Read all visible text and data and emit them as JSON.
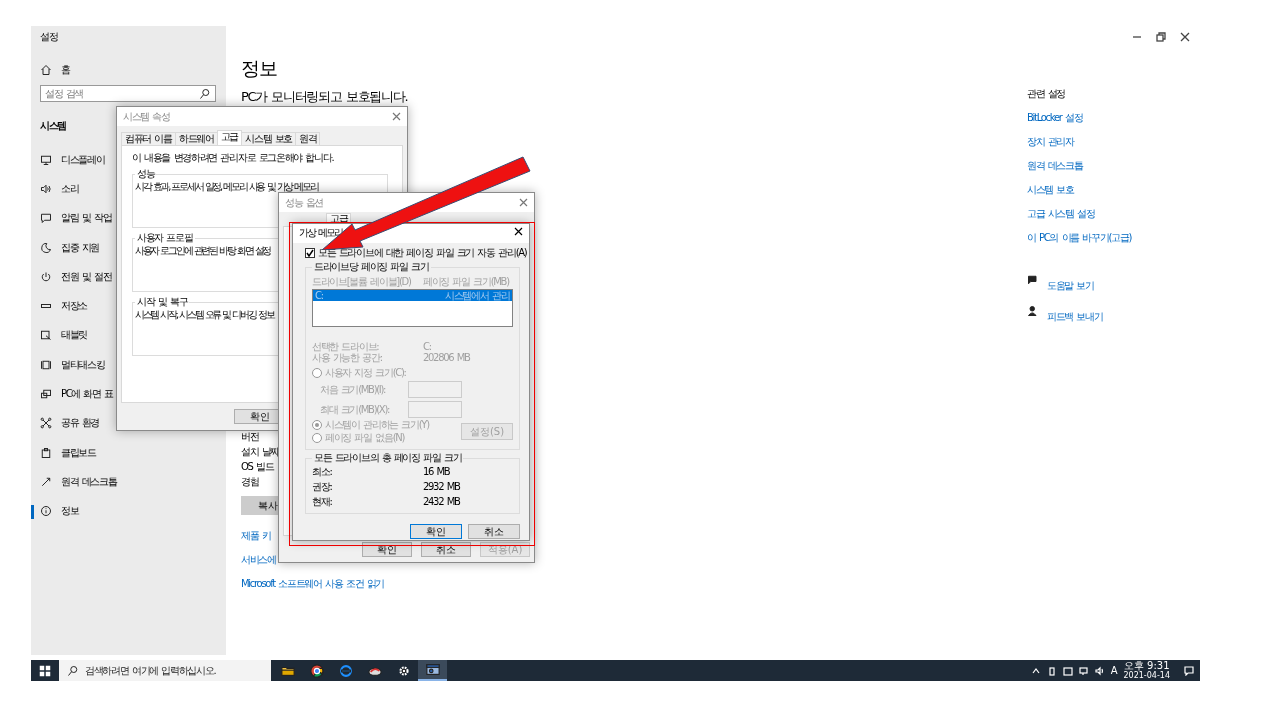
{
  "settings": {
    "title": "설정",
    "sidebar": {
      "home": "홈",
      "search": {
        "placeholder": "설정 검색"
      },
      "section": "시스템",
      "items": [
        {
          "label": "디스플레이",
          "selected": false
        },
        {
          "label": "소리",
          "selected": false
        },
        {
          "label": "알림 및 작업",
          "selected": false
        },
        {
          "label": "집중 지원",
          "selected": false
        },
        {
          "label": "전원 및 절전",
          "selected": false
        },
        {
          "label": "저장소",
          "selected": false
        },
        {
          "label": "태블릿",
          "selected": false
        },
        {
          "label": "멀티태스킹",
          "selected": false
        },
        {
          "label": "PC에 화면 표",
          "selected": false
        },
        {
          "label": "공유 환경",
          "selected": false
        },
        {
          "label": "클립보드",
          "selected": false
        },
        {
          "label": "원격 데스크톱",
          "selected": false
        },
        {
          "label": "정보",
          "selected": true
        }
      ]
    },
    "content": {
      "heading": "정보",
      "status": "PC가 모니터링되고 보호됩니다.",
      "spec_labels": [
        "버전",
        "설치 날짜",
        "OS 빌드",
        "경험"
      ],
      "copy_button": "복사",
      "links": [
        "제품 키",
        "서비스에",
        "Microsoft 소프트웨어 사용 조건 읽기"
      ]
    },
    "related": {
      "heading": "관련 설정",
      "links": [
        "BitLocker 설정",
        "장치 관리자",
        "원격 데스크톱",
        "시스템 보호",
        "고급 시스템 설정",
        "이 PC의 이름 바꾸기(고급)"
      ],
      "help": [
        "도움말 보기",
        "피드백 보내기"
      ]
    }
  },
  "system_properties": {
    "title": "시스템 속성",
    "tabs": [
      {
        "label": "컴퓨터 이름",
        "selected": false
      },
      {
        "label": "하드웨어",
        "selected": false
      },
      {
        "label": "고급",
        "selected": true
      },
      {
        "label": "시스템 보호",
        "selected": false
      },
      {
        "label": "원격",
        "selected": false
      }
    ],
    "notice": "이 내용을 변경하려면 관리자로 로그온해야 합니다.",
    "groups": [
      {
        "title": "성능",
        "description": "시각 효과, 프로세서 일정, 메모리 사용 및 가상 메모리"
      },
      {
        "title": "사용자 프로필",
        "description": "사용자 로그인에 관련된 바탕 화면 설정"
      },
      {
        "title": "시작 및 복구",
        "description": "시스템 시작, 시스템 오류 및 디버깅 정보"
      }
    ],
    "buttons": [
      "확인"
    ]
  },
  "performance_options": {
    "title": "성능 옵션",
    "tabs": [
      {
        "label": "고급",
        "selected": true
      }
    ],
    "buttons": [
      {
        "label": "확인",
        "disabled": false
      },
      {
        "label": "취소",
        "disabled": false
      },
      {
        "label": "적용(A)",
        "disabled": true
      }
    ]
  },
  "virtual_memory": {
    "title": "가상 메모리",
    "auto_manage": {
      "label": "모든 드라이브에 대한 페이징 파일 크기 자동 관리(A)",
      "checked": true
    },
    "per_drive": {
      "title": "드라이브당 페이징 파일 크기",
      "columns": [
        "드라이브[볼륨 레이블](D)",
        "페이징 파일 크기(MB)"
      ],
      "rows": [
        {
          "drive": "C:",
          "size": "시스템에서 관리",
          "selected": true
        }
      ],
      "info": [
        {
          "label": "선택한 드라이브:",
          "value": "C:"
        },
        {
          "label": "사용 가능한 공간:",
          "value": "202806 MB"
        }
      ],
      "options": [
        {
          "label": "사용자 지정 크기(C):",
          "selected": false
        },
        {
          "label": "시스템이 관리하는 크기(Y)",
          "selected": true
        },
        {
          "label": "페이징 파일 없음(N)",
          "selected": false
        }
      ],
      "fields": [
        "처음 크기(MB)(I):",
        "최대 크기(MB)(X):"
      ],
      "set_button": {
        "label": "설정(S)",
        "disabled": true
      }
    },
    "totals": {
      "title": "모든 드라이브의 총 페이징 파일 크기",
      "rows": [
        {
          "label": "최소:",
          "value": "16 MB"
        },
        {
          "label": "권장:",
          "value": "2932 MB"
        },
        {
          "label": "현재:",
          "value": "2432 MB"
        }
      ]
    },
    "buttons": [
      {
        "label": "확인",
        "default": true
      },
      {
        "label": "취소",
        "default": false
      }
    ]
  },
  "taskbar": {
    "search_placeholder": "검색하려면 여기에 입력하십시오.",
    "apps": [
      {
        "active": false
      },
      {
        "active": false
      },
      {
        "active": false
      },
      {
        "active": false
      },
      {
        "active": false
      },
      {
        "active": true
      }
    ],
    "ime": "A",
    "time": "오후 9:31",
    "date": "2021-04-14"
  }
}
